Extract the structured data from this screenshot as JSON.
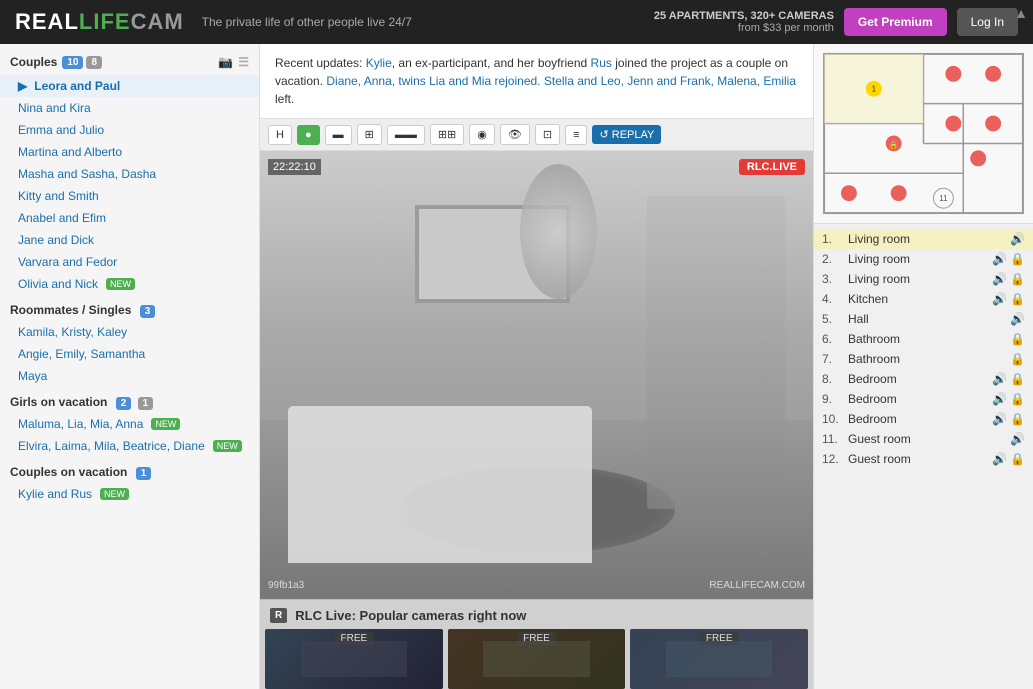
{
  "header": {
    "logo_real": "REAL",
    "logo_life": "LIFE",
    "logo_cam": "CAM",
    "tagline": "The private life of other people live 24/7",
    "apt_info_line1": "25 APARTMENTS, 320+ CAMERAS",
    "apt_info_line2": "from $33 per month",
    "btn_premium": "Get Premium",
    "btn_login": "Log In"
  },
  "sidebar": {
    "section_couples": "Couples",
    "couples_count1": "10",
    "couples_count2": "8",
    "couples_items": [
      {
        "label": "Leora and Paul",
        "active": true
      },
      {
        "label": "Nina and Kira",
        "active": false
      },
      {
        "label": "Emma and Julio",
        "active": false
      },
      {
        "label": "Martina and Alberto",
        "active": false
      },
      {
        "label": "Masha and Sasha, Dasha",
        "active": false
      },
      {
        "label": "Kitty and Smith",
        "active": false
      },
      {
        "label": "Anabel and Efim",
        "active": false
      },
      {
        "label": "Jane and Dick",
        "active": false
      },
      {
        "label": "Varvara and Fedor",
        "active": false
      },
      {
        "label": "Olivia and Nick",
        "active": false,
        "new": true
      }
    ],
    "section_roommates": "Roommates / Singles",
    "roommates_count": "3",
    "roommates_items": [
      {
        "label": "Kamila, Kristy, Kaley"
      },
      {
        "label": "Angie, Emily, Samantha"
      },
      {
        "label": "Maya"
      }
    ],
    "section_girls": "Girls on vacation",
    "girls_count1": "2",
    "girls_count2": "1",
    "girls_items": [
      {
        "label": "Maluma, Lia, Mia, Anna",
        "new": true
      },
      {
        "label": "Elvira, Laima, Mila, Beatrice, Diane",
        "new": true
      }
    ],
    "section_couples_vacation": "Couples on vacation",
    "couples_vacation_count": "1",
    "couples_vacation_items": [
      {
        "label": "Kylie and Rus",
        "new": true
      }
    ]
  },
  "news": {
    "text1": "Recent updates: ",
    "kylie": "Kylie",
    "text2": ", an ex-participant, and her boyfriend ",
    "rus": "Rus",
    "text3": " joined the project as a couple on vacation. ",
    "diane": "Diane, Anna, twins Lia and Mia rejoined.",
    "text4": " ",
    "stella": "Stella and Leo, Jenn and Frank, Malena, Emilia",
    "text5": " left."
  },
  "video": {
    "timestamp": "22:22:10",
    "live_label": "RLC.LIVE",
    "video_id": "99fb1a3",
    "watermark": "REALLIFECAM.COM"
  },
  "controls": {
    "hd": "H",
    "rec": "●",
    "wide": "▬",
    "multi1": "⊞",
    "multi2": "▬",
    "multi3": "⊞",
    "multi4": "◉",
    "eye": "👁",
    "cam": "⊡",
    "info": "≡",
    "replay": "↺ REPLAY"
  },
  "rooms": [
    {
      "num": "1.",
      "name": "Living room",
      "sound": true,
      "lock": false,
      "active": true
    },
    {
      "num": "2.",
      "name": "Living room",
      "sound": true,
      "lock": true,
      "active": false
    },
    {
      "num": "3.",
      "name": "Living room",
      "sound": true,
      "lock": true,
      "active": false
    },
    {
      "num": "4.",
      "name": "Kitchen",
      "sound": true,
      "lock": true,
      "active": false
    },
    {
      "num": "5.",
      "name": "Hall",
      "sound": true,
      "lock": false,
      "active": false
    },
    {
      "num": "6.",
      "name": "Bathroom",
      "sound": false,
      "lock": true,
      "active": false
    },
    {
      "num": "7.",
      "name": "Bathroom",
      "sound": false,
      "lock": true,
      "active": false
    },
    {
      "num": "8.",
      "name": "Bedroom",
      "sound": true,
      "lock": true,
      "active": false
    },
    {
      "num": "9.",
      "name": "Bedroom",
      "sound": true,
      "lock": true,
      "active": false
    },
    {
      "num": "10.",
      "name": "Bedroom",
      "sound": true,
      "lock": true,
      "active": false
    },
    {
      "num": "11.",
      "name": "Guest room",
      "sound": true,
      "lock": false,
      "active": false
    },
    {
      "num": "12.",
      "name": "Guest room",
      "sound": true,
      "lock": true,
      "active": false
    }
  ],
  "bottom": {
    "rlc_label": "R",
    "title": "RLC Live: Popular cameras right now",
    "free_label": "FREE",
    "thumbs": [
      {
        "label": "FREE"
      },
      {
        "label": "FREE"
      },
      {
        "label": "FREE"
      }
    ]
  }
}
